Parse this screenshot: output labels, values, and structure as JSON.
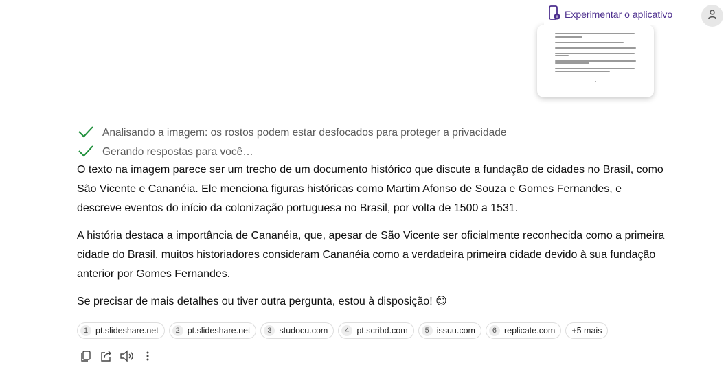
{
  "header": {
    "app_button_label": "Experimentar o aplicativo"
  },
  "steps": [
    "Analisando a imagem: os rostos podem estar desfocados para proteger a privacidade",
    "Gerando respostas para você…"
  ],
  "answer": {
    "p1": "O texto na imagem parece ser um trecho de um documento histórico que discute a fundação de cidades no Brasil, como São Vicente e Cananéia. Ele menciona figuras históricas como Martim Afonso de Souza e Gomes Fernandes, e descreve eventos do início da colonização portuguesa no Brasil, por volta de 1500 a 1531.",
    "p2": "A história destaca a importância de Cananéia, que, apesar de São Vicente ser oficialmente reconhecida como a primeira cidade do Brasil, muitos historiadores consideram Cananéia como a verdadeira primeira cidade devido à sua fundação anterior por Gomes Fernandes.",
    "p3": "Se precisar de mais detalhes ou tiver outra pergunta, estou à disposição! 😊"
  },
  "sources": [
    {
      "num": "1",
      "label": "pt.slideshare.net"
    },
    {
      "num": "2",
      "label": "pt.slideshare.net"
    },
    {
      "num": "3",
      "label": "studocu.com"
    },
    {
      "num": "4",
      "label": "pt.scribd.com"
    },
    {
      "num": "5",
      "label": "issuu.com"
    },
    {
      "num": "6",
      "label": "replicate.com"
    }
  ],
  "sources_more": "+5 mais",
  "icons": {
    "app": "phone-chat-icon",
    "avatar": "user-icon",
    "check": "check-icon",
    "copy": "copy-icon",
    "share": "share-icon",
    "speaker": "speaker-icon",
    "more": "more-vertical-icon"
  },
  "colors": {
    "accent": "#4d2f8e",
    "check": "#1e8f3a",
    "step_text": "#5c5c5c"
  }
}
